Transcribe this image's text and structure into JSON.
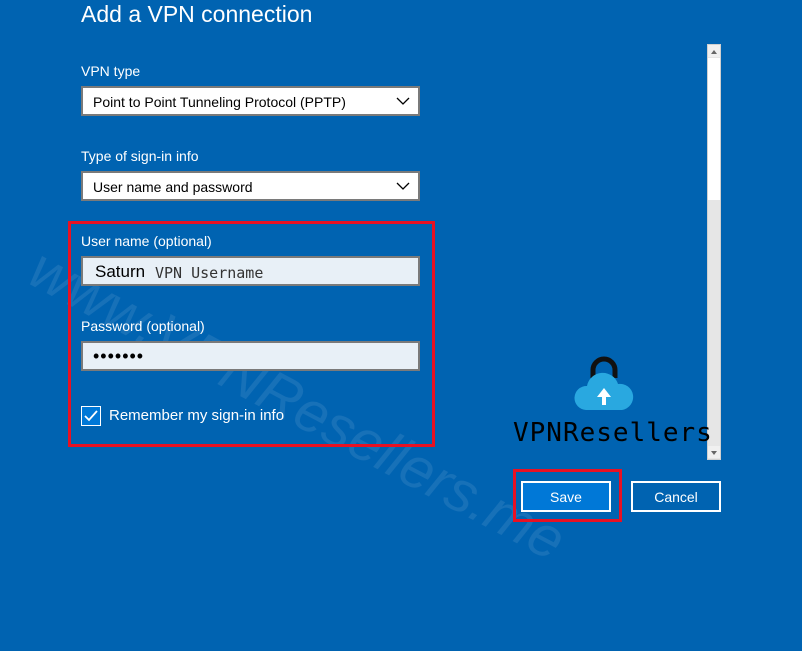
{
  "dialog": {
    "title": "Add a VPN connection"
  },
  "vpn_type": {
    "label": "VPN type",
    "selected": "Point to Point Tunneling Protocol (PPTP)"
  },
  "signin_type": {
    "label": "Type of sign-in info",
    "selected": "User name and password"
  },
  "username": {
    "label": "User name (optional)",
    "value": "Saturn",
    "placeholder": "VPN Username"
  },
  "password": {
    "label": "Password (optional)",
    "value": "•••••••"
  },
  "remember": {
    "label": "Remember my sign-in info",
    "checked": true
  },
  "buttons": {
    "save": "Save",
    "cancel": "Cancel"
  },
  "branding": {
    "logo_text": "VPNResellers",
    "watermark": "www.VPNResellers.me"
  },
  "colors": {
    "background": "#0063b1",
    "highlight": "#e81123",
    "accent": "#0078d7"
  }
}
